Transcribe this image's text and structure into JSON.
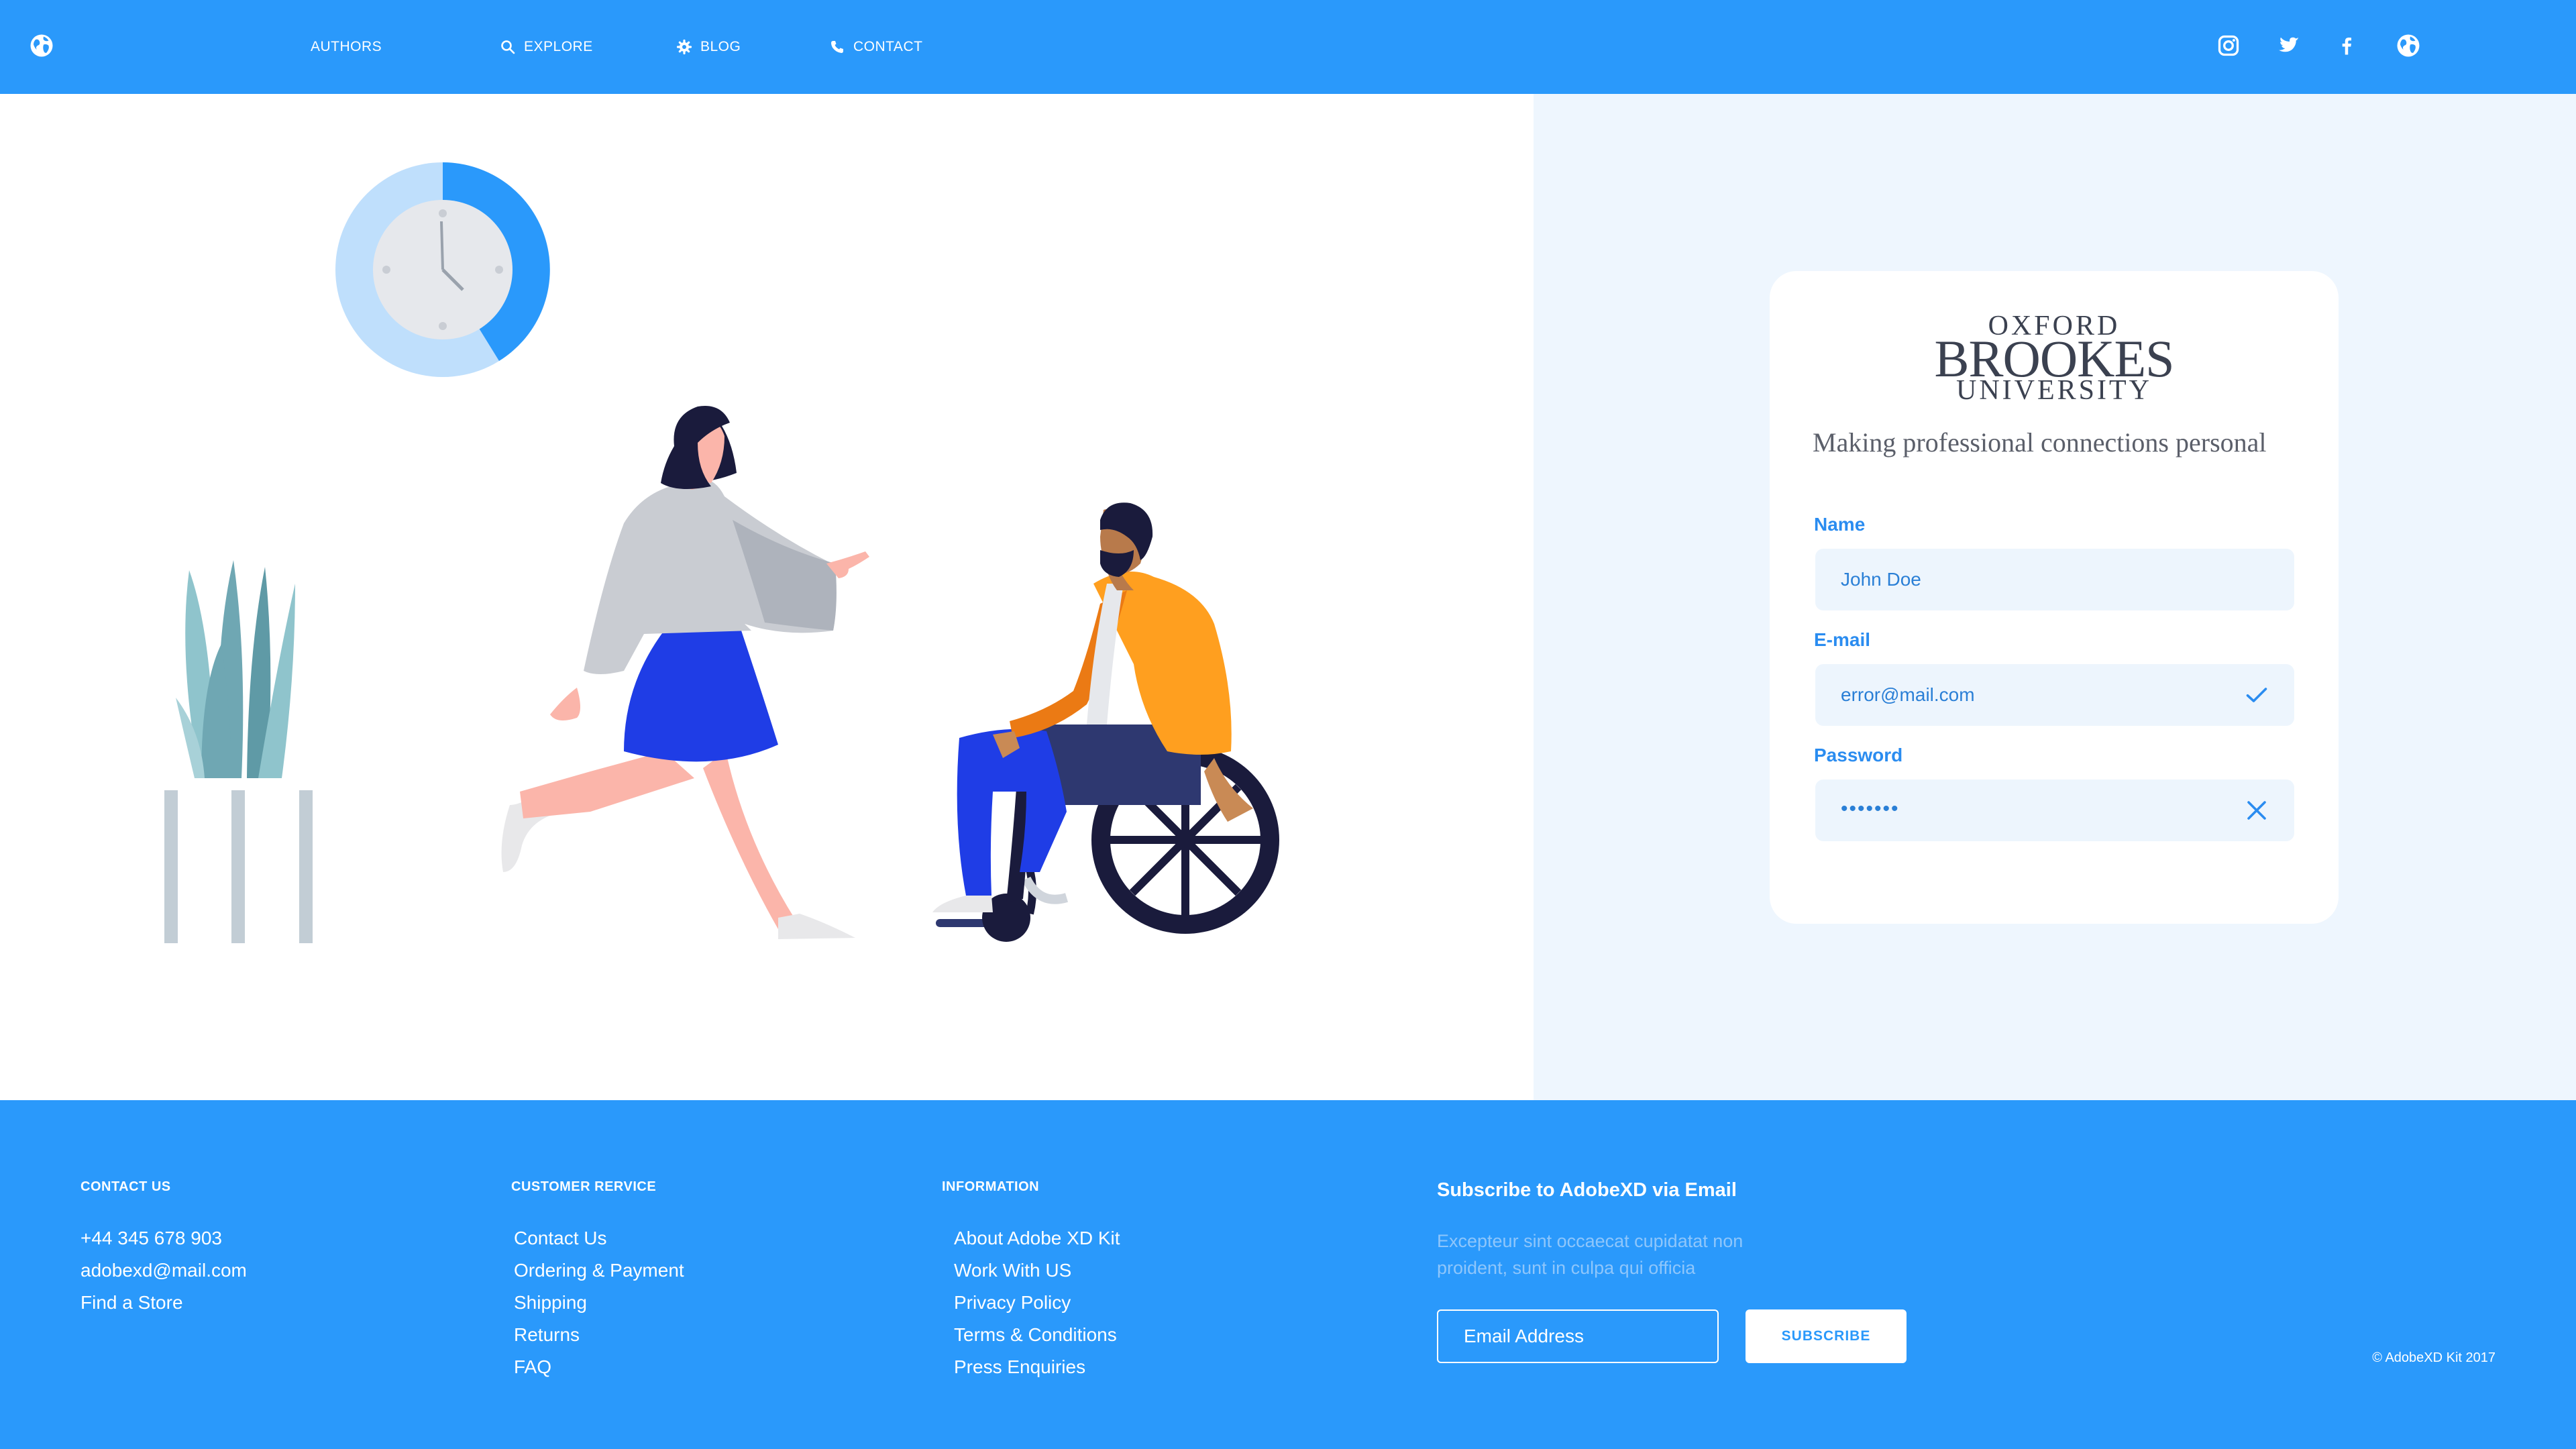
{
  "nav": {
    "logo_icon": "globe-icon",
    "items": [
      {
        "label": "AUTHORS",
        "icon": ""
      },
      {
        "label": "EXPLORE",
        "icon": "search-icon"
      },
      {
        "label": "BLOG",
        "icon": "gear-icon"
      },
      {
        "label": "CONTACT",
        "icon": "phone-icon"
      }
    ],
    "social": [
      "instagram-icon",
      "twitter-icon",
      "facebook-icon",
      "globe-icon"
    ]
  },
  "card": {
    "brand_line1": "OXFORD",
    "brand_line2": "BROOKES",
    "brand_line3": "UNIVERSITY",
    "tagline": "Making professional connections personal",
    "fields": [
      {
        "label": "Name",
        "value": "John Doe",
        "status": ""
      },
      {
        "label": "E-mail",
        "value": "error@mail.com",
        "status": "check-icon"
      },
      {
        "label": "Password",
        "value": "•••••••",
        "status": "cross-icon"
      }
    ]
  },
  "footer": {
    "contact_heading": "CONTACT US",
    "contact_items": [
      "+44 345 678 903",
      "adobexd@mail.com",
      "Find a Store"
    ],
    "service_heading": "CUSTOMER RERVICE",
    "service_items": [
      "Contact Us",
      "Ordering & Payment",
      "Shipping",
      "Returns",
      "FAQ"
    ],
    "info_heading": "INFORMATION",
    "info_items": [
      "About Adobe XD Kit",
      "Work With US",
      "Privacy Policy",
      "Terms & Conditions",
      "Press Enquiries"
    ],
    "subscribe_title": "Subscribe to AdobeXD via Email",
    "subscribe_desc": "Excepteur sint occaecat cupidatat non proident, sunt in culpa qui officia",
    "email_placeholder": "Email Address",
    "subscribe_button": "SUBSCRIBE",
    "copyright": "© AdobeXD Kit 2017"
  },
  "colors": {
    "primary": "#2a99fb",
    "panel": "#eef6fe",
    "field": "#edf5fd",
    "label": "#2a8cf0",
    "brand_text": "#3b4150"
  }
}
